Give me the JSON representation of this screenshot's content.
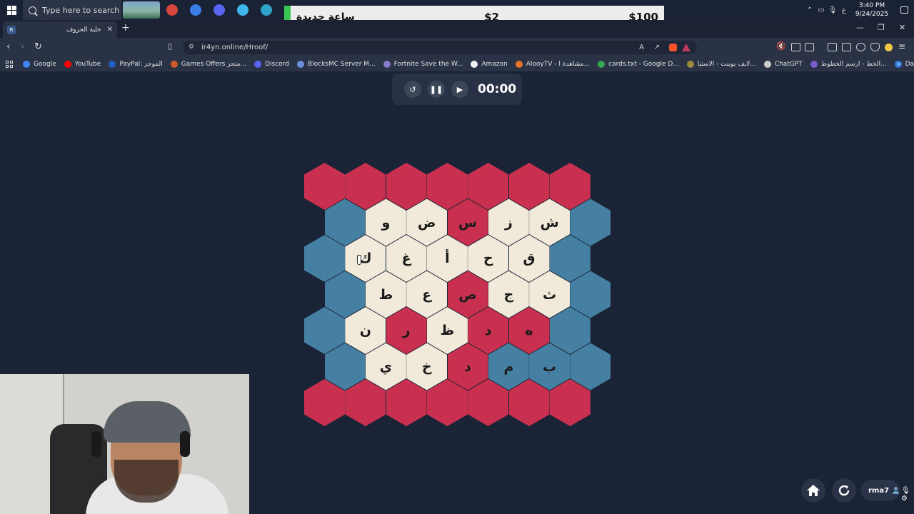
{
  "taskbar": {
    "search_placeholder": "Type here to search",
    "apps": [
      {
        "name": "chrome-1",
        "color": "#d9463b"
      },
      {
        "name": "chrome-2",
        "color": "#3a7ee8"
      },
      {
        "name": "discord",
        "color": "#5865f2"
      },
      {
        "name": "app-blue",
        "color": "#3db7ec"
      },
      {
        "name": "app-teal",
        "color": "#2fa3c8"
      }
    ],
    "tray_lang": "ع",
    "time": "3:40 PM",
    "date": "9/24/2025"
  },
  "overlay": {
    "text": "ساعة جديدة",
    "mid": "$2",
    "right": "$100",
    "accent": "#39c553"
  },
  "browser": {
    "tab_title": "خلية الحروف",
    "favicon": "R",
    "url": "ir4yn.online/Hroof/",
    "bookmarks": [
      {
        "label": "Google",
        "color": "#4285f4"
      },
      {
        "label": "YouTube",
        "color": "#ff0000"
      },
      {
        "label": "PayPal: الموجز",
        "color": "#1f5fbf"
      },
      {
        "label": "Games Offers متجر...",
        "color": "#d05a2a"
      },
      {
        "label": "Discord",
        "color": "#5865f2"
      },
      {
        "label": "BlocksMC Server M...",
        "color": "#6a8fd8"
      },
      {
        "label": "Fortnite Save the W...",
        "color": "#8a78c8"
      },
      {
        "label": "Amazon",
        "color": "#f2f2f2"
      },
      {
        "label": "AlooyTV - مشاهدة ا...",
        "color": "#e8732a"
      },
      {
        "label": "cards.txt - Google D...",
        "color": "#34a853"
      },
      {
        "label": "لايف بوينت - الاستيا...",
        "color": "#9a8a3a"
      },
      {
        "label": "ChatGPT",
        "color": "#cccccc"
      },
      {
        "label": "الخط - ارسم الخطوط...",
        "color": "#7b5cc9"
      },
      {
        "label": "Dashboard - Stream...",
        "color": "#2d7be5"
      }
    ]
  },
  "game": {
    "timer": "00:00",
    "controls": [
      "reset",
      "pause",
      "play"
    ],
    "colors": {
      "red": "#c9304f",
      "blue": "#4580a3",
      "cream": "#f1e9d9"
    },
    "rows": [
      [
        {
          "c": "red",
          "l": ""
        },
        {
          "c": "red",
          "l": ""
        },
        {
          "c": "red",
          "l": ""
        },
        {
          "c": "red",
          "l": ""
        },
        {
          "c": "red",
          "l": ""
        },
        {
          "c": "red",
          "l": ""
        },
        {
          "c": "red",
          "l": ""
        }
      ],
      [
        {
          "c": "blue",
          "l": ""
        },
        {
          "c": "cream",
          "l": "و"
        },
        {
          "c": "cream",
          "l": "ض"
        },
        {
          "c": "red",
          "l": "س"
        },
        {
          "c": "cream",
          "l": "ز"
        },
        {
          "c": "cream",
          "l": "ش"
        },
        {
          "c": "blue",
          "l": ""
        }
      ],
      [
        {
          "c": "blue",
          "l": ""
        },
        {
          "c": "cream",
          "l": "ك"
        },
        {
          "c": "cream",
          "l": "غ"
        },
        {
          "c": "cream",
          "l": "أ"
        },
        {
          "c": "cream",
          "l": "ح"
        },
        {
          "c": "cream",
          "l": "ق"
        },
        {
          "c": "blue",
          "l": ""
        }
      ],
      [
        {
          "c": "blue",
          "l": ""
        },
        {
          "c": "cream",
          "l": "ط"
        },
        {
          "c": "cream",
          "l": "ع"
        },
        {
          "c": "red",
          "l": "ص"
        },
        {
          "c": "cream",
          "l": "ج"
        },
        {
          "c": "cream",
          "l": "ث"
        },
        {
          "c": "blue",
          "l": ""
        }
      ],
      [
        {
          "c": "blue",
          "l": ""
        },
        {
          "c": "cream",
          "l": "ن"
        },
        {
          "c": "red",
          "l": "ر"
        },
        {
          "c": "cream",
          "l": "ظ"
        },
        {
          "c": "red",
          "l": "ذ"
        },
        {
          "c": "red",
          "l": "ه"
        },
        {
          "c": "blue",
          "l": ""
        }
      ],
      [
        {
          "c": "blue",
          "l": ""
        },
        {
          "c": "cream",
          "l": "ي"
        },
        {
          "c": "cream",
          "l": "خ"
        },
        {
          "c": "red",
          "l": "د"
        },
        {
          "c": "blue",
          "l": "م"
        },
        {
          "c": "blue",
          "l": "ب"
        },
        {
          "c": "blue",
          "l": ""
        }
      ],
      [
        {
          "c": "red",
          "l": ""
        },
        {
          "c": "red",
          "l": ""
        },
        {
          "c": "red",
          "l": ""
        },
        {
          "c": "red",
          "l": ""
        },
        {
          "c": "red",
          "l": ""
        },
        {
          "c": "red",
          "l": ""
        },
        {
          "c": "red",
          "l": ""
        }
      ]
    ]
  },
  "user": {
    "name": "rma7"
  }
}
